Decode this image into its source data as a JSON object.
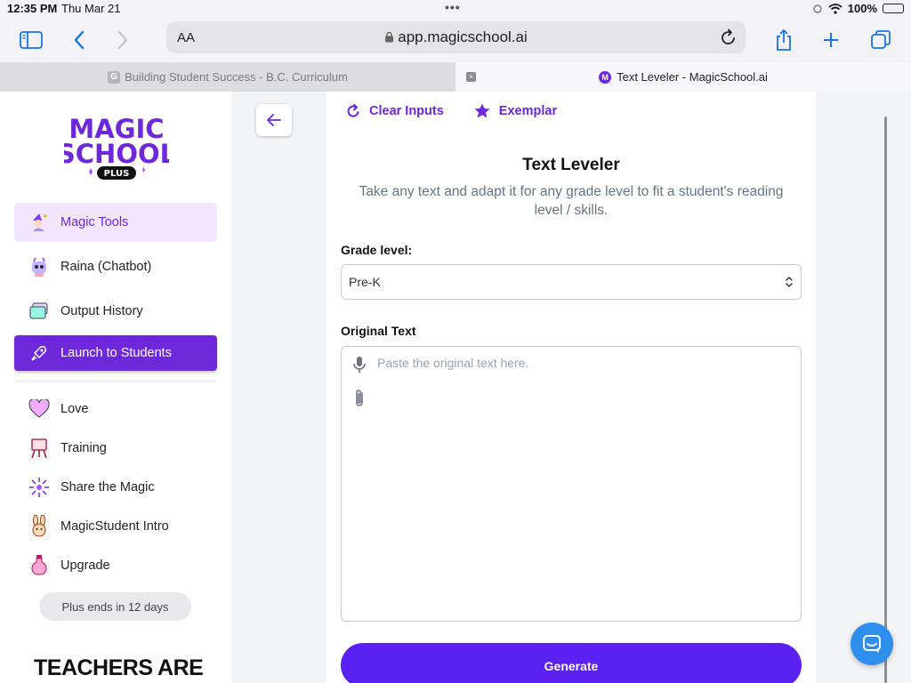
{
  "status_bar": {
    "time": "12:35 PM",
    "date": "Thu Mar 21",
    "battery": "100%"
  },
  "browser": {
    "aa_label": "AA",
    "url": "app.magicschool.ai",
    "tabs": [
      {
        "label": "Building Student Success - B.C. Curriculum",
        "favicon": "G",
        "active": false
      },
      {
        "label": "Text Leveler - MagicSchool.ai",
        "favicon": "M",
        "active": true
      }
    ],
    "tab_close_glyph": "×"
  },
  "sidebar": {
    "logo": {
      "line1": "MAGIC",
      "line2": "SCHOOL",
      "badge": "PLUS"
    },
    "items": [
      {
        "label": "Magic Tools",
        "icon": "wizard-icon"
      },
      {
        "label": "Raina (Chatbot)",
        "icon": "robot-icon"
      },
      {
        "label": "Output History",
        "icon": "history-stack-icon"
      },
      {
        "label": "Launch to Students",
        "icon": "rocket-icon"
      },
      {
        "label": "Love",
        "icon": "heart-icon"
      },
      {
        "label": "Training",
        "icon": "easel-icon"
      },
      {
        "label": "Share the Magic",
        "icon": "sparkle-burst-icon"
      },
      {
        "label": "MagicStudent Intro",
        "icon": "bunny-icon"
      },
      {
        "label": "Upgrade",
        "icon": "potion-icon"
      }
    ],
    "plan_notice": "Plus ends in 12 days",
    "banner_text": "TEACHERS ARE"
  },
  "tool": {
    "clear_inputs": "Clear Inputs",
    "exemplar": "Exemplar",
    "title": "Text Leveler",
    "subtitle": "Take any text and adapt it for any grade level to fit a student's reading level / skills.",
    "grade_label": "Grade level:",
    "grade_value": "Pre-K",
    "original_label": "Original Text",
    "original_placeholder": "Paste the original text here.",
    "generate_label": "Generate"
  },
  "colors": {
    "brand_purple": "#6d28d9",
    "generate_blue": "#5b21f2",
    "chat_fab": "#2f8fec"
  }
}
